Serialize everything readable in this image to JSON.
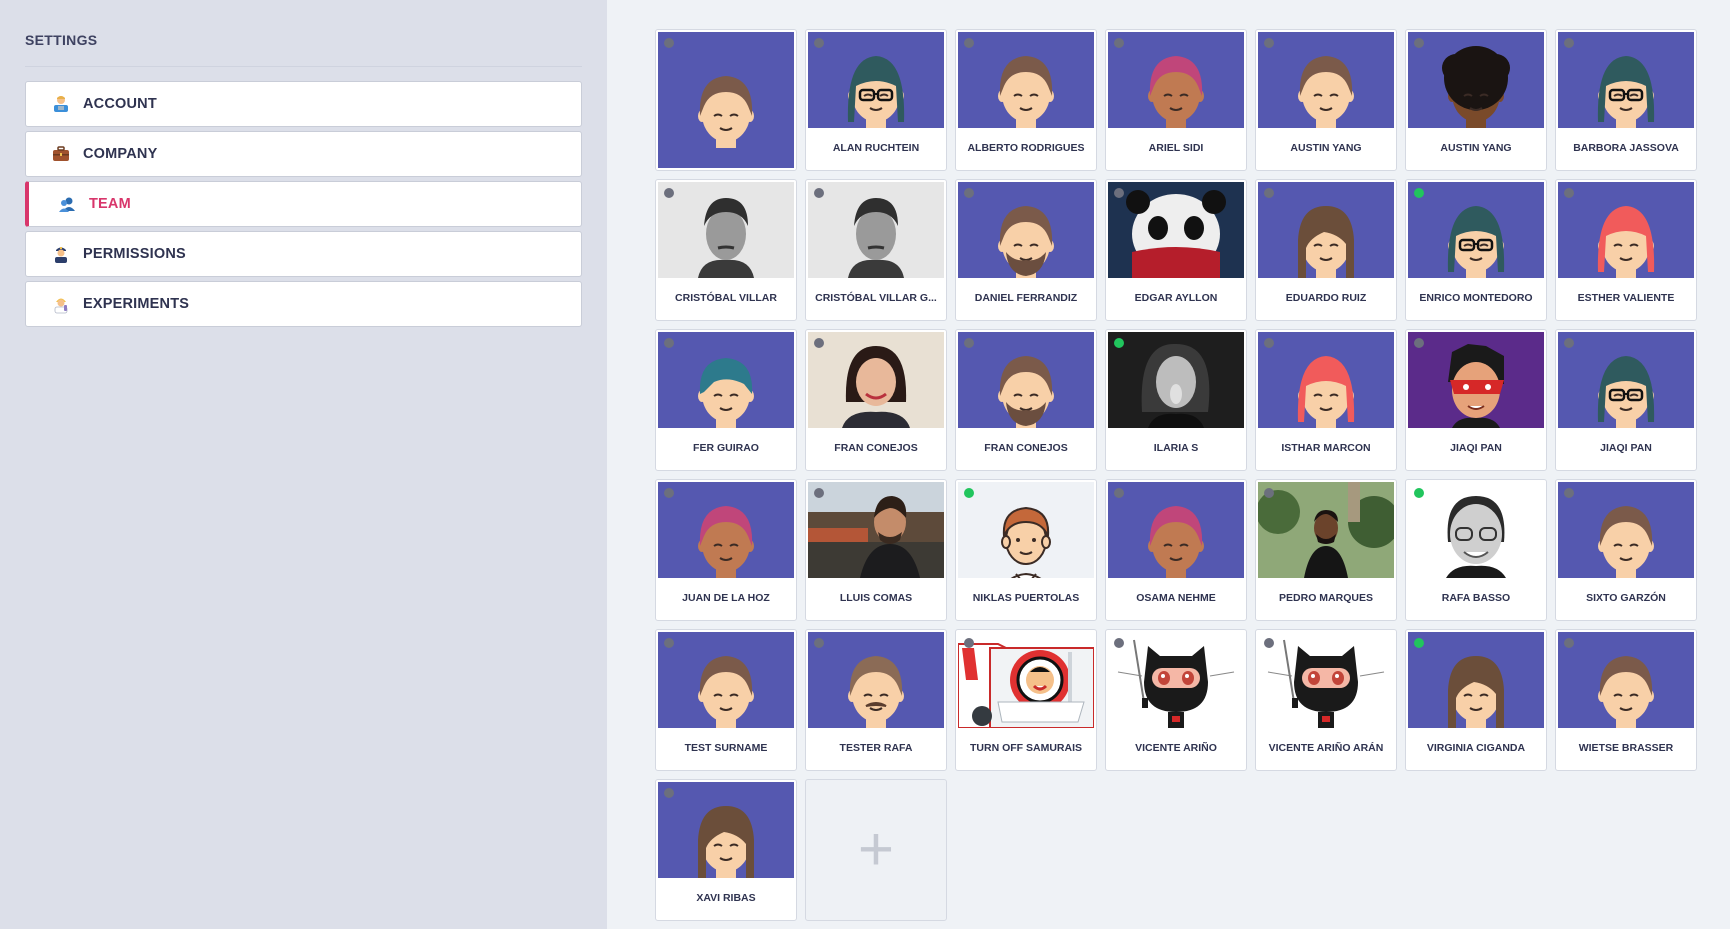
{
  "sidebar": {
    "title": "SETTINGS",
    "items": [
      {
        "label": "ACCOUNT",
        "icon": "account-icon",
        "active": false
      },
      {
        "label": "COMPANY",
        "icon": "briefcase-icon",
        "active": false
      },
      {
        "label": "TEAM",
        "icon": "team-icon",
        "active": true
      },
      {
        "label": "PERMISSIONS",
        "icon": "police-officer-icon",
        "active": false
      },
      {
        "label": "EXPERIMENTS",
        "icon": "scientist-icon",
        "active": false
      }
    ]
  },
  "colors": {
    "active_accent": "#d8366b",
    "avatar_bg": "#5558b0",
    "online": "#21c55d",
    "offline": "#6c6f7d"
  },
  "team": {
    "members": [
      {
        "name": "",
        "status": "offline",
        "avatar": "cartoon-boy"
      },
      {
        "name": "ALAN RUCHTEIN",
        "status": "offline",
        "avatar": "cartoon-girl-glasses"
      },
      {
        "name": "ALBERTO RODRIGUES",
        "status": "offline",
        "avatar": "cartoon-boy"
      },
      {
        "name": "ARIEL SIDI",
        "status": "offline",
        "avatar": "cartoon-pink-hair"
      },
      {
        "name": "AUSTIN YANG",
        "status": "offline",
        "avatar": "cartoon-boy"
      },
      {
        "name": "AUSTIN YANG",
        "status": "offline",
        "avatar": "cartoon-afro"
      },
      {
        "name": "BARBORA JASSOVA",
        "status": "offline",
        "avatar": "cartoon-girl-glasses"
      },
      {
        "name": "CRISTÓBAL VILLAR",
        "status": "offline",
        "avatar": "photo-man-bw"
      },
      {
        "name": "CRISTÓBAL VILLAR G...",
        "status": "offline",
        "avatar": "photo-man-bw"
      },
      {
        "name": "DANIEL FERRANDIZ",
        "status": "offline",
        "avatar": "cartoon-beard"
      },
      {
        "name": "EDGAR AYLLON",
        "status": "offline",
        "avatar": "photo-panda"
      },
      {
        "name": "EDUARDO RUIZ",
        "status": "offline",
        "avatar": "cartoon-long-hair"
      },
      {
        "name": "ENRICO MONTEDORO",
        "status": "online",
        "avatar": "cartoon-girl-glasses"
      },
      {
        "name": "ESTHER VALIENTE",
        "status": "offline",
        "avatar": "cartoon-red-hair"
      },
      {
        "name": "FER GUIRAO",
        "status": "offline",
        "avatar": "cartoon-teal-hair"
      },
      {
        "name": "FRAN CONEJOS",
        "status": "offline",
        "avatar": "photo-woman-smile"
      },
      {
        "name": "FRAN CONEJOS",
        "status": "offline",
        "avatar": "cartoon-beard"
      },
      {
        "name": "ILARIA S",
        "status": "online",
        "avatar": "photo-woman-bw"
      },
      {
        "name": "ISTHAR MARCON",
        "status": "offline",
        "avatar": "cartoon-red-hair"
      },
      {
        "name": "JIAQI PAN",
        "status": "offline",
        "avatar": "cartoon-masked"
      },
      {
        "name": "JIAQI PAN",
        "status": "offline",
        "avatar": "cartoon-girl-glasses"
      },
      {
        "name": "JUAN DE LA HOZ",
        "status": "offline",
        "avatar": "cartoon-pink-hair"
      },
      {
        "name": "LLUIS COMAS",
        "status": "offline",
        "avatar": "photo-man-outdoor"
      },
      {
        "name": "NIKLAS PUERTOLAS",
        "status": "online",
        "avatar": "cartoon-white-bg"
      },
      {
        "name": "OSAMA NEHME",
        "status": "offline",
        "avatar": "cartoon-pink-hair"
      },
      {
        "name": "PEDRO MARQUES",
        "status": "offline",
        "avatar": "photo-man-garden"
      },
      {
        "name": "RAFA BASSO",
        "status": "online",
        "avatar": "photo-woman-glasses"
      },
      {
        "name": "SIXTO GARZÓN",
        "status": "offline",
        "avatar": "cartoon-boy"
      },
      {
        "name": "TEST SURNAME",
        "status": "offline",
        "avatar": "cartoon-boy"
      },
      {
        "name": "TESTER RAFA",
        "status": "offline",
        "avatar": "cartoon-mustache"
      },
      {
        "name": "TURN OFF SAMURAIS",
        "status": "offline",
        "avatar": "photo-logo"
      },
      {
        "name": "VICENTE ARIÑO",
        "status": "offline",
        "avatar": "octocat-ninja"
      },
      {
        "name": "VICENTE ARIÑO ARÁN",
        "status": "offline",
        "avatar": "octocat-ninja"
      },
      {
        "name": "VIRGINIA CIGANDA",
        "status": "online",
        "avatar": "cartoon-long-hair"
      },
      {
        "name": "WIETSE BRASSER",
        "status": "offline",
        "avatar": "cartoon-boy"
      },
      {
        "name": "XAVI RIBAS",
        "status": "offline",
        "avatar": "cartoon-long-hair"
      }
    ],
    "add_label": "+"
  }
}
